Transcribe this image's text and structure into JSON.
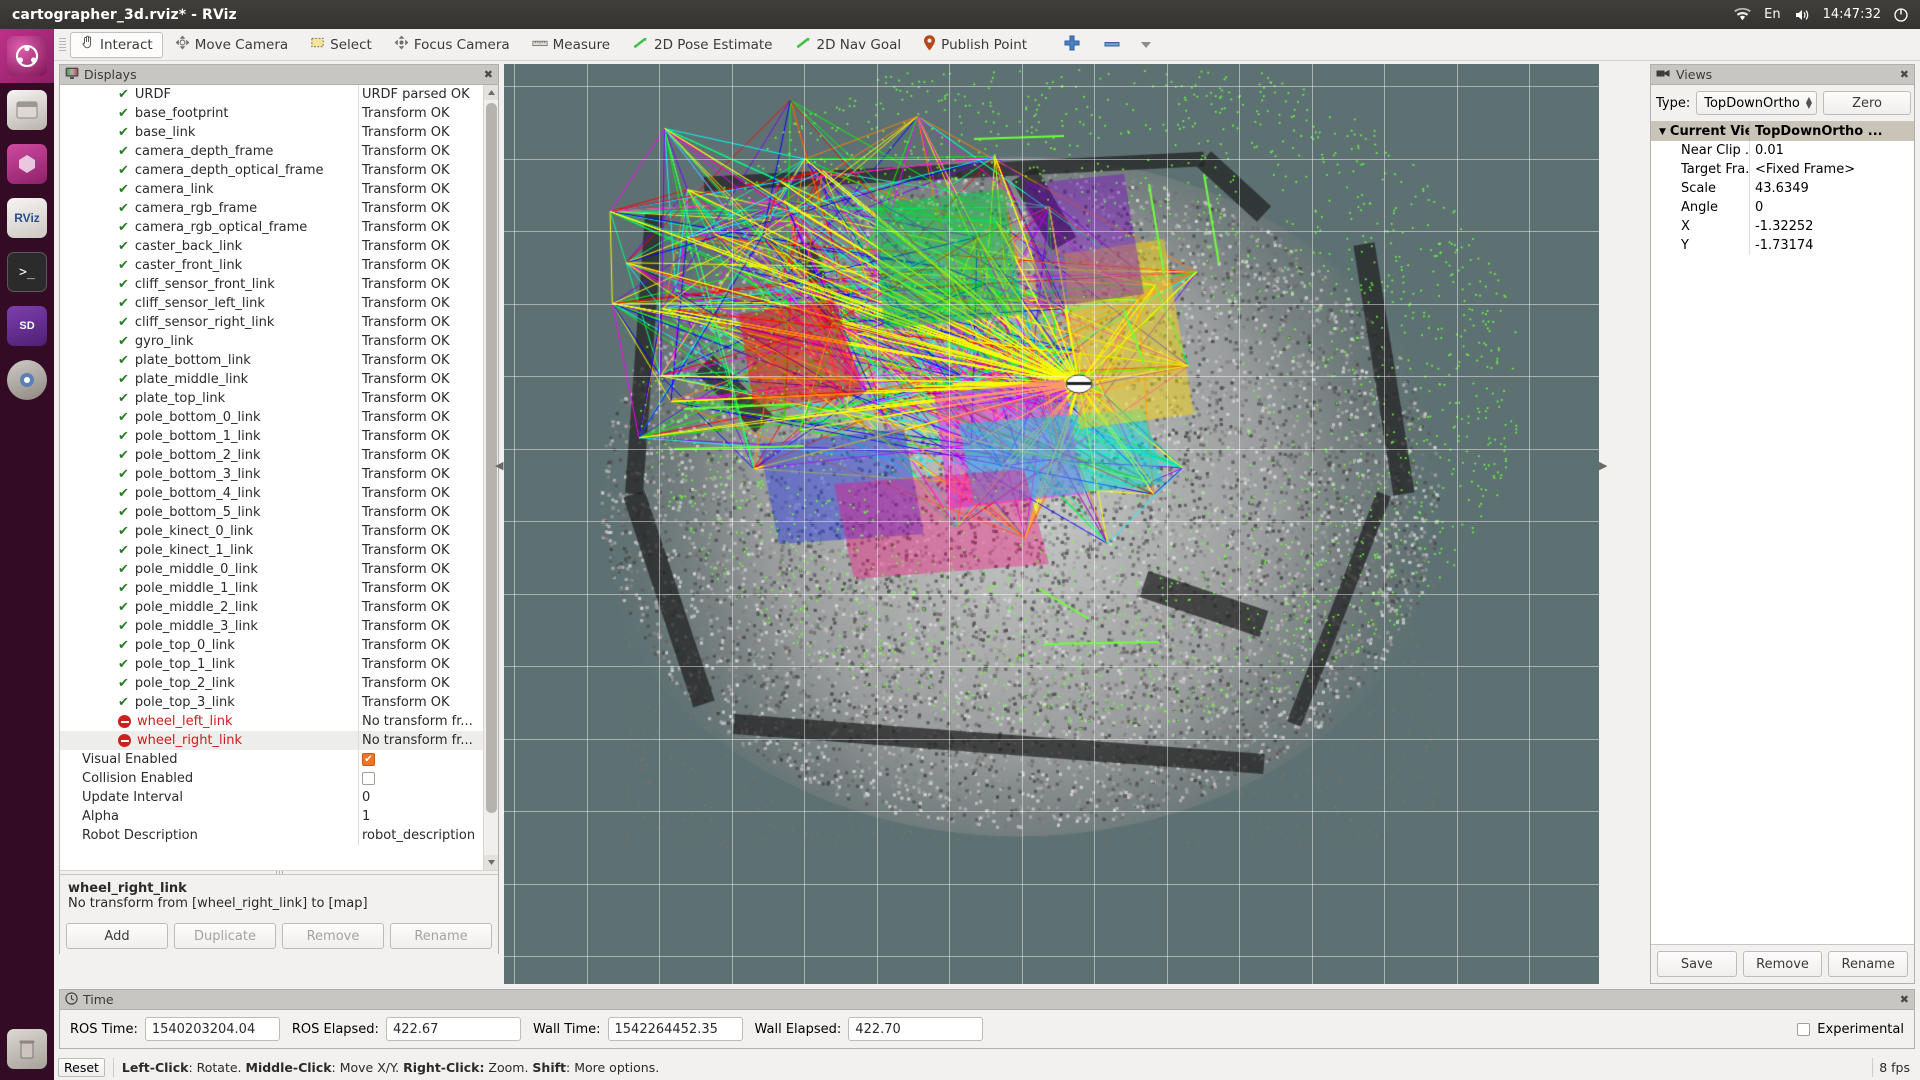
{
  "window": {
    "title": "cartographer_3d.rviz* - RViz"
  },
  "systray": {
    "keyboard": "En",
    "clock": "14:47:32",
    "icons": [
      "wifi-icon",
      "keyboard-layout-icon",
      "volume-icon",
      "clock-icon",
      "session-menu-icon"
    ]
  },
  "launcher": {
    "items": [
      "ubuntu-dash-icon",
      "files-icon",
      "software-center-icon",
      "rviz-icon",
      "terminal-icon",
      "sd-card-icon",
      "system-settings-icon",
      "trash-icon"
    ]
  },
  "toolbar": {
    "buttons": [
      {
        "label": "Interact",
        "icon": "hand-cursor-icon",
        "active": true
      },
      {
        "label": "Move Camera",
        "icon": "move-camera-icon",
        "active": false
      },
      {
        "label": "Select",
        "icon": "select-rect-icon",
        "active": false
      },
      {
        "label": "Focus Camera",
        "icon": "focus-camera-icon",
        "active": false
      },
      {
        "label": "Measure",
        "icon": "ruler-icon",
        "active": false
      },
      {
        "label": "2D Pose Estimate",
        "icon": "pose-arrow-icon",
        "active": false
      },
      {
        "label": "2D Nav Goal",
        "icon": "nav-goal-arrow-icon",
        "active": false
      },
      {
        "label": "Publish Point",
        "icon": "map-pin-icon",
        "active": false
      }
    ],
    "add_tool_icon": "plus-icon",
    "remove_tool_icon": "minus-icon",
    "overflow_icon": "chevron-down-icon"
  },
  "displays": {
    "title": "Displays",
    "title_icon": "display-monitor-icon",
    "close_icon": "close-icon",
    "rows": [
      {
        "label": "URDF",
        "value": "URDF parsed OK",
        "state": "ok"
      },
      {
        "label": "base_footprint",
        "value": "Transform OK",
        "state": "ok"
      },
      {
        "label": "base_link",
        "value": "Transform OK",
        "state": "ok"
      },
      {
        "label": "camera_depth_frame",
        "value": "Transform OK",
        "state": "ok"
      },
      {
        "label": "camera_depth_optical_frame",
        "value": "Transform OK",
        "state": "ok"
      },
      {
        "label": "camera_link",
        "value": "Transform OK",
        "state": "ok"
      },
      {
        "label": "camera_rgb_frame",
        "value": "Transform OK",
        "state": "ok"
      },
      {
        "label": "camera_rgb_optical_frame",
        "value": "Transform OK",
        "state": "ok"
      },
      {
        "label": "caster_back_link",
        "value": "Transform OK",
        "state": "ok"
      },
      {
        "label": "caster_front_link",
        "value": "Transform OK",
        "state": "ok"
      },
      {
        "label": "cliff_sensor_front_link",
        "value": "Transform OK",
        "state": "ok"
      },
      {
        "label": "cliff_sensor_left_link",
        "value": "Transform OK",
        "state": "ok"
      },
      {
        "label": "cliff_sensor_right_link",
        "value": "Transform OK",
        "state": "ok"
      },
      {
        "label": "gyro_link",
        "value": "Transform OK",
        "state": "ok"
      },
      {
        "label": "plate_bottom_link",
        "value": "Transform OK",
        "state": "ok"
      },
      {
        "label": "plate_middle_link",
        "value": "Transform OK",
        "state": "ok"
      },
      {
        "label": "plate_top_link",
        "value": "Transform OK",
        "state": "ok"
      },
      {
        "label": "pole_bottom_0_link",
        "value": "Transform OK",
        "state": "ok"
      },
      {
        "label": "pole_bottom_1_link",
        "value": "Transform OK",
        "state": "ok"
      },
      {
        "label": "pole_bottom_2_link",
        "value": "Transform OK",
        "state": "ok"
      },
      {
        "label": "pole_bottom_3_link",
        "value": "Transform OK",
        "state": "ok"
      },
      {
        "label": "pole_bottom_4_link",
        "value": "Transform OK",
        "state": "ok"
      },
      {
        "label": "pole_bottom_5_link",
        "value": "Transform OK",
        "state": "ok"
      },
      {
        "label": "pole_kinect_0_link",
        "value": "Transform OK",
        "state": "ok"
      },
      {
        "label": "pole_kinect_1_link",
        "value": "Transform OK",
        "state": "ok"
      },
      {
        "label": "pole_middle_0_link",
        "value": "Transform OK",
        "state": "ok"
      },
      {
        "label": "pole_middle_1_link",
        "value": "Transform OK",
        "state": "ok"
      },
      {
        "label": "pole_middle_2_link",
        "value": "Transform OK",
        "state": "ok"
      },
      {
        "label": "pole_middle_3_link",
        "value": "Transform OK",
        "state": "ok"
      },
      {
        "label": "pole_top_0_link",
        "value": "Transform OK",
        "state": "ok"
      },
      {
        "label": "pole_top_1_link",
        "value": "Transform OK",
        "state": "ok"
      },
      {
        "label": "pole_top_2_link",
        "value": "Transform OK",
        "state": "ok"
      },
      {
        "label": "pole_top_3_link",
        "value": "Transform OK",
        "state": "ok"
      },
      {
        "label": "wheel_left_link",
        "value": "No transform fr...",
        "state": "error"
      },
      {
        "label": "wheel_right_link",
        "value": "No transform fr...",
        "state": "error",
        "selected": true
      }
    ],
    "properties": [
      {
        "label": "Visual Enabled",
        "type": "checkbox",
        "checked": true
      },
      {
        "label": "Collision Enabled",
        "type": "checkbox",
        "checked": false
      },
      {
        "label": "Update Interval",
        "type": "text",
        "value": "0"
      },
      {
        "label": "Alpha",
        "type": "text",
        "value": "1"
      },
      {
        "label": "Robot Description",
        "type": "text",
        "value": "robot_description"
      }
    ],
    "status": {
      "title": "wheel_right_link",
      "message": "No transform from [wheel_right_link] to [map]"
    },
    "buttons": [
      {
        "label": "Add",
        "enabled": true
      },
      {
        "label": "Duplicate",
        "enabled": false
      },
      {
        "label": "Remove",
        "enabled": false
      },
      {
        "label": "Rename",
        "enabled": false
      }
    ]
  },
  "views": {
    "title": "Views",
    "title_icon": "camera-icon",
    "close_icon": "close-icon",
    "type_label": "Type:",
    "type_value": "TopDownOrtho",
    "zero_button": "Zero",
    "header": {
      "name": "Current View",
      "value": "TopDownOrtho ..."
    },
    "properties": [
      {
        "label": "Near Clip ...",
        "value": "0.01"
      },
      {
        "label": "Target Fra...",
        "value": "<Fixed Frame>"
      },
      {
        "label": "Scale",
        "value": "43.6349"
      },
      {
        "label": "Angle",
        "value": "0"
      },
      {
        "label": "X",
        "value": "-1.32252"
      },
      {
        "label": "Y",
        "value": "-1.73174"
      }
    ],
    "buttons": [
      {
        "label": "Save"
      },
      {
        "label": "Remove"
      },
      {
        "label": "Rename"
      }
    ]
  },
  "time": {
    "title": "Time",
    "title_icon": "clock-icon",
    "close_icon": "close-icon",
    "fields": [
      {
        "label": "ROS Time:",
        "value": "1540203204.04"
      },
      {
        "label": "ROS Elapsed:",
        "value": "422.67"
      },
      {
        "label": "Wall Time:",
        "value": "1542264452.35"
      },
      {
        "label": "Wall Elapsed:",
        "value": "422.70"
      }
    ],
    "experimental_label": "Experimental",
    "experimental_checked": false
  },
  "statusbar": {
    "reset_label": "Reset",
    "hint_parts": [
      {
        "bold": "Left-Click",
        "text": ": Rotate. "
      },
      {
        "bold": "Middle-Click",
        "text": ": Move X/Y. "
      },
      {
        "bold": "Right-Click:",
        "text": ": Zoom. "
      },
      {
        "bold": "Shift",
        "text": ": More options."
      }
    ],
    "hint_full": "Left-Click: Rotate. Middle-Click: Move X/Y. Right-Click:: Zoom. Shift: More options.",
    "fps": "8 fps"
  },
  "viewport": {
    "background_color": "#5d7173",
    "grid_color": "#ffffff",
    "description": "top-down ortho 3D view showing grayscale occupancy / point-cloud map of a room with colored SLAM trajectory constraint lines (yellow, green, magenta, cyan, red, blue) and a robot marker near the center"
  }
}
